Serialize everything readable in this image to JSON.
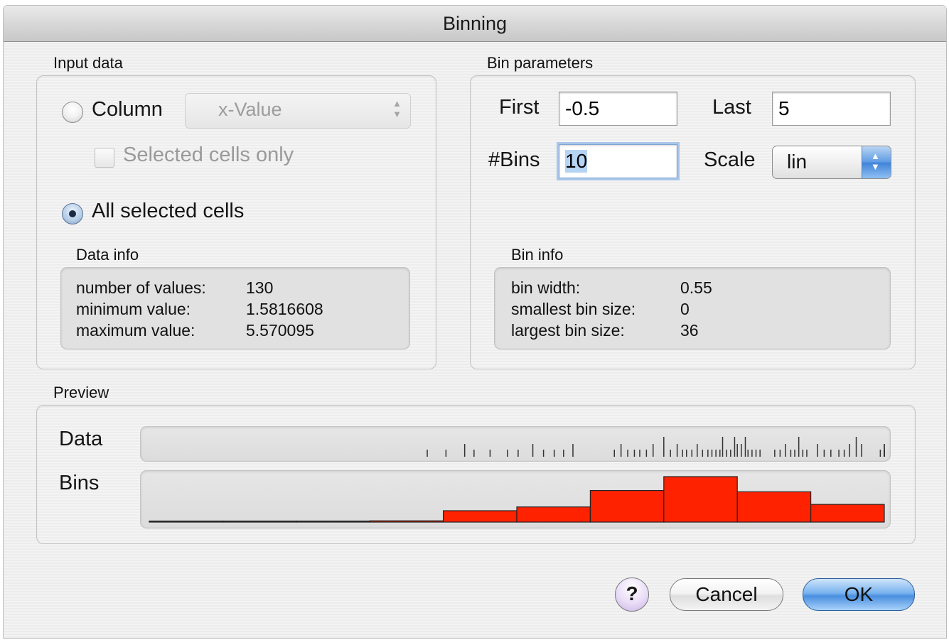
{
  "window": {
    "title": "Binning"
  },
  "input_data": {
    "label": "Input data",
    "column_option": {
      "label": "Column",
      "selected": false
    },
    "column_popup": {
      "value": "x-Value",
      "enabled": false
    },
    "selected_cells_only": {
      "label": "Selected cells only",
      "checked": false,
      "enabled": false
    },
    "all_selected_option": {
      "label": "All selected cells",
      "selected": true
    },
    "data_info": {
      "label": "Data info",
      "rows": [
        {
          "key": "number of values:",
          "value": "130"
        },
        {
          "key": "minimum value:",
          "value": "1.5816608"
        },
        {
          "key": "maximum value:",
          "value": "5.570095"
        }
      ]
    }
  },
  "bin_parameters": {
    "label": "Bin parameters",
    "first": {
      "label": "First",
      "value": "-0.5"
    },
    "last": {
      "label": "Last",
      "value": "5"
    },
    "bins": {
      "label": "#Bins",
      "value": "10"
    },
    "scale": {
      "label": "Scale",
      "value": "lin"
    },
    "bin_info": {
      "label": "Bin info",
      "rows": [
        {
          "key": "bin width:",
          "value": "0.55"
        },
        {
          "key": "smallest bin size:",
          "value": "0"
        },
        {
          "key": "largest bin size:",
          "value": "36"
        }
      ]
    }
  },
  "preview": {
    "label": "Preview",
    "data_label": "Data",
    "bins_label": "Bins",
    "bin_color": "#ff2200",
    "bins": [
      0,
      0,
      0,
      1,
      9,
      12,
      25,
      36,
      24,
      14
    ],
    "bins_max": 36,
    "data_ticks": [
      1.58,
      1.72,
      1.86,
      1.93,
      2.05,
      2.18,
      2.26,
      2.37,
      2.45,
      2.53,
      2.6,
      2.67,
      2.98,
      3.03,
      3.08,
      3.13,
      3.17,
      3.22,
      3.27,
      3.35,
      3.4,
      3.45,
      3.49,
      3.52,
      3.56,
      3.6,
      3.64,
      3.68,
      3.71,
      3.74,
      3.77,
      3.79,
      3.82,
      3.85,
      3.88,
      3.9,
      3.93,
      3.96,
      3.98,
      4.01,
      4.04,
      4.07,
      4.18,
      4.22,
      4.26,
      4.3,
      4.33,
      4.36,
      4.39,
      4.42,
      4.5,
      4.55,
      4.6,
      4.66,
      4.7,
      4.74,
      4.79,
      4.83,
      4.97,
      5.03,
      5.08,
      5.13,
      5.2,
      5.36,
      5.43,
      5.5,
      5.57
    ],
    "data_ticks_tall": [
      3.35,
      3.79,
      3.88,
      3.96,
      4.36,
      4.79
    ]
  },
  "buttons": {
    "help": "?",
    "cancel": "Cancel",
    "ok": "OK"
  }
}
